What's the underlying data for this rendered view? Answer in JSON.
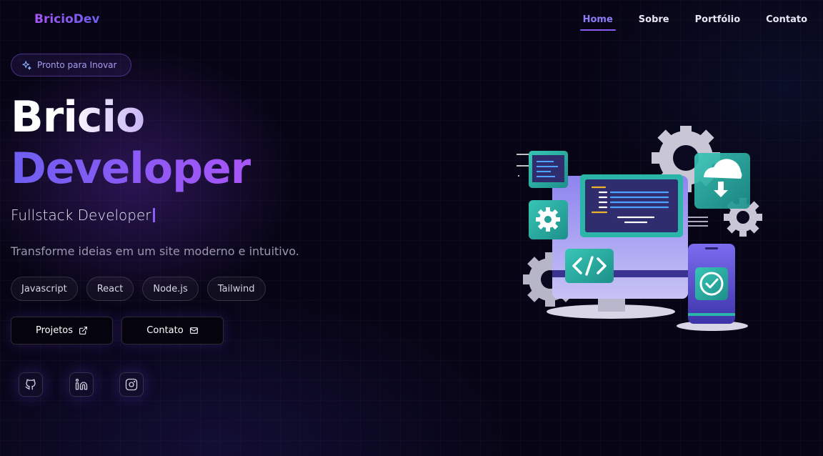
{
  "nav": {
    "logo": "BricioDev",
    "links": [
      "Home",
      "Sobre",
      "Portfólio",
      "Contato"
    ],
    "active_index": 0
  },
  "hero": {
    "badge": "Pronto para Inovar",
    "title_line1": "Bricio",
    "title_line2": "Developer",
    "subtitle": "Fullstack Developer",
    "description": "Transforme ideias em um site moderno e intuitivo.",
    "tags": [
      "Javascript",
      "React",
      "Node.js",
      "Tailwind"
    ],
    "buttons": {
      "projects": "Projetos",
      "contact": "Contato"
    },
    "social_icons": [
      "github-icon",
      "linkedin-icon",
      "instagram-icon"
    ]
  },
  "colors": {
    "accent": "#8b5cf6",
    "background": "#070515",
    "teal": "#2bb5a8"
  }
}
